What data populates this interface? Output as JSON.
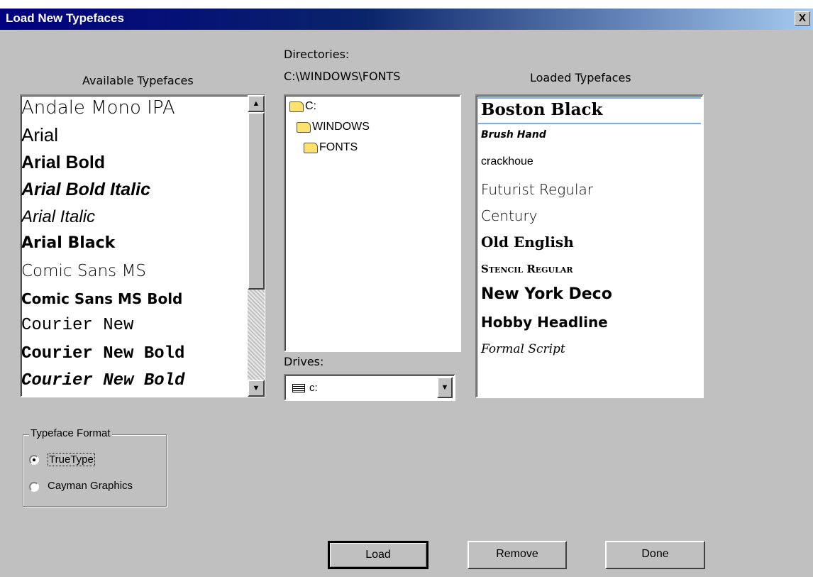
{
  "window": {
    "title": "Load New Typefaces",
    "close_label": "X"
  },
  "available": {
    "label": "Available Typefaces",
    "items": [
      "Andale Mono IPA",
      "Arial",
      "Arial Bold",
      "Arial Bold Italic",
      "Arial Italic",
      "Arial Black",
      "Comic Sans MS",
      "Comic Sans MS Bold",
      "Courier New",
      "Courier New Bold",
      "Courier New Bold"
    ],
    "scroll_up": "▲",
    "scroll_down": "▼"
  },
  "directories": {
    "label": "Directories:",
    "path": "C:\\WINDOWS\\FONTS",
    "tree": [
      "C:",
      "WINDOWS",
      "FONTS"
    ]
  },
  "drives": {
    "label": "Drives:",
    "selected": "c:",
    "arrow": "▼"
  },
  "loaded": {
    "label": "Loaded Typefaces",
    "items": [
      "Boston Black",
      "Brush Hand",
      "crackhoue",
      "Futurist Regular",
      "Century",
      "Old English",
      "Stencil Regular",
      "New York Deco",
      "Hobby Headline",
      "Formal Script"
    ]
  },
  "format": {
    "title": "Typeface Format",
    "options": [
      "TrueType",
      "Cayman Graphics"
    ],
    "selected": "TrueType"
  },
  "buttons": {
    "load": "Load",
    "remove": "Remove",
    "done": "Done"
  },
  "colors": {
    "titlebar_start": "#000080",
    "dialog_bg": "#c0c0c0",
    "selection": "#6ab0ff"
  }
}
